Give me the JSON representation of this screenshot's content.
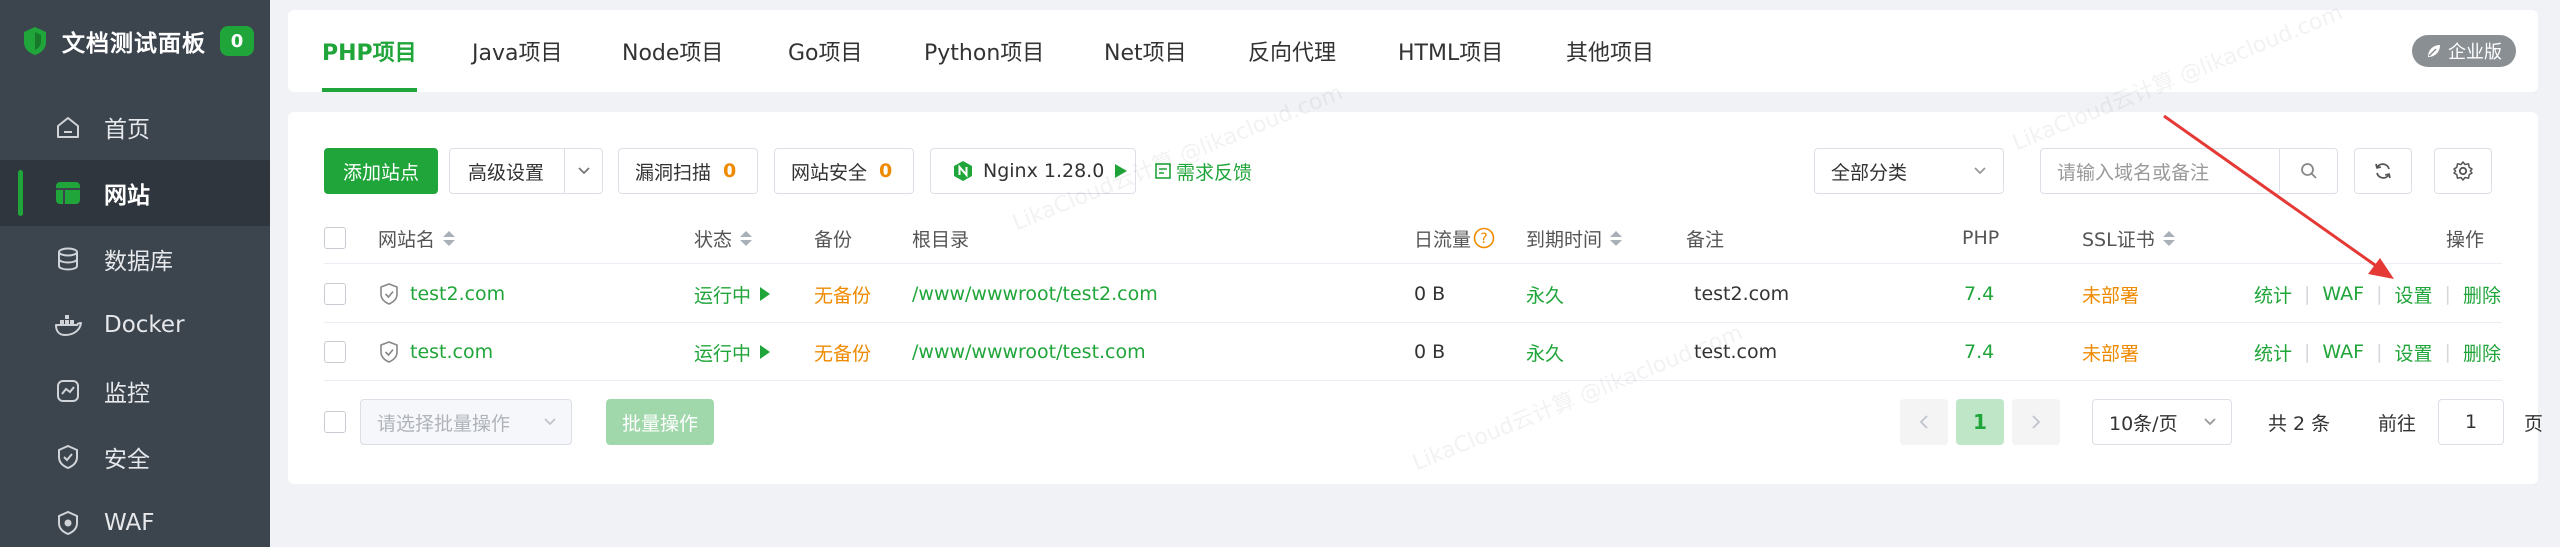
{
  "sidebar": {
    "brand": "文档测试面板",
    "count": "0",
    "items": [
      {
        "label": "首页",
        "icon": "home-icon",
        "active": false
      },
      {
        "label": "网站",
        "icon": "website-icon",
        "active": true
      },
      {
        "label": "数据库",
        "icon": "database-icon",
        "active": false
      },
      {
        "label": "Docker",
        "icon": "docker-icon",
        "active": false
      },
      {
        "label": "监控",
        "icon": "monitor-icon",
        "active": false
      },
      {
        "label": "安全",
        "icon": "shield-icon",
        "active": false
      },
      {
        "label": "WAF",
        "icon": "waf-icon",
        "active": false
      }
    ]
  },
  "tabs": [
    {
      "label": "PHP项目",
      "active": true
    },
    {
      "label": "Java项目"
    },
    {
      "label": "Node项目"
    },
    {
      "label": "Go项目"
    },
    {
      "label": "Python项目"
    },
    {
      "label": "Net项目"
    },
    {
      "label": "反向代理"
    },
    {
      "label": "HTML项目"
    },
    {
      "label": "其他项目"
    }
  ],
  "enterprise_label": "企业版",
  "toolbar": {
    "add_site": "添加站点",
    "advanced": "高级设置",
    "vuln_scan": "漏洞扫描",
    "vuln_scan_count": "0",
    "site_security": "网站安全",
    "site_security_count": "0",
    "nginx": "Nginx 1.28.0",
    "feedback": "需求反馈",
    "category": "全部分类",
    "search_placeholder": "请输入域名或备注"
  },
  "table": {
    "headers": {
      "name": "网站名",
      "status": "状态",
      "backup": "备份",
      "root": "根目录",
      "traffic": "日流量",
      "expire": "到期时间",
      "remark": "备注",
      "php": "PHP",
      "ssl": "SSL证书",
      "ops": "操作"
    },
    "rows": [
      {
        "name": "test2.com",
        "status": "运行中",
        "backup": "无备份",
        "root": "/www/wwwroot/test2.com",
        "traffic": "0 B",
        "expire": "永久",
        "remark": "test2.com",
        "php": "7.4",
        "ssl": "未部署",
        "ops": [
          "统计",
          "WAF",
          "设置",
          "删除"
        ]
      },
      {
        "name": "test.com",
        "status": "运行中",
        "backup": "无备份",
        "root": "/www/wwwroot/test.com",
        "traffic": "0 B",
        "expire": "永久",
        "remark": "test.com",
        "php": "7.4",
        "ssl": "未部署",
        "ops": [
          "统计",
          "WAF",
          "设置",
          "删除"
        ]
      }
    ]
  },
  "footer": {
    "batch_placeholder": "请选择批量操作",
    "batch_button": "批量操作",
    "current_page": "1",
    "page_size": "10条/页",
    "total": "共 2 条",
    "goto_label": "前往",
    "goto_value": "1",
    "page_unit": "页"
  },
  "colors": {
    "accent": "#20a53a",
    "warning": "#ef8a00",
    "sidebar_bg": "#3c444d",
    "annotation_arrow": "#e53935"
  }
}
